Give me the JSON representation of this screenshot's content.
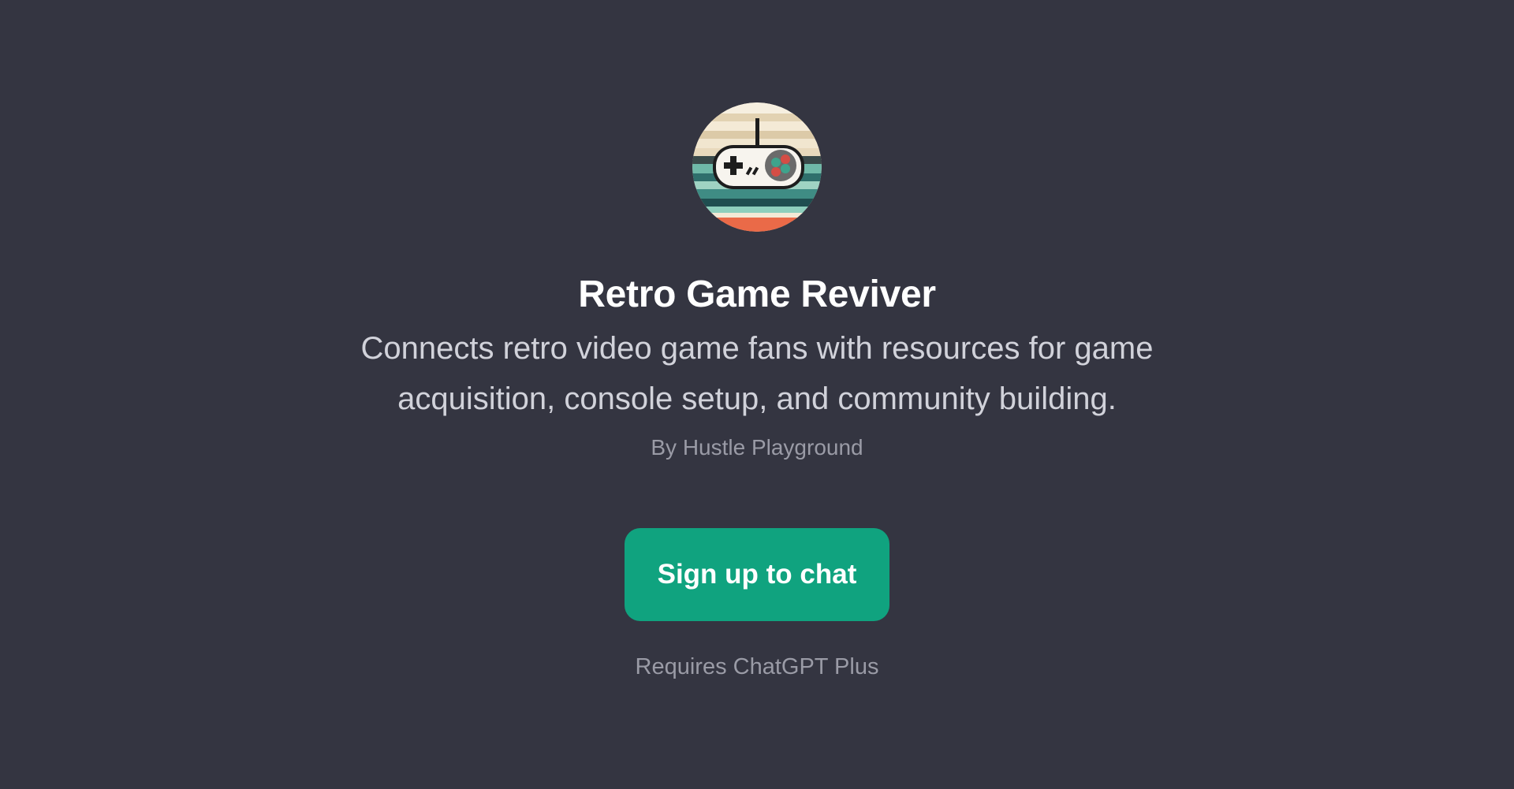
{
  "gpt": {
    "avatar_icon": "retro-gamepad-pixel-art",
    "title": "Retro Game Reviver",
    "description": "Connects retro video game fans with resources for game acquisition, console setup, and community building.",
    "author": "By Hustle Playground"
  },
  "cta": {
    "signup_label": "Sign up to chat",
    "requirement": "Requires ChatGPT Plus"
  },
  "colors": {
    "background": "#343541",
    "accent": "#10a37f",
    "title": "#ffffff",
    "muted": "#9a9ba6"
  }
}
